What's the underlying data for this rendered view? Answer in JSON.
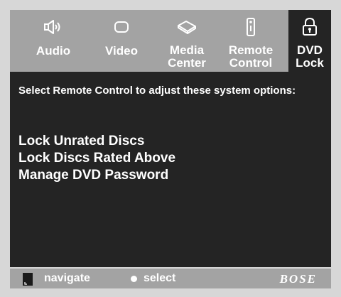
{
  "tabs": [
    {
      "id": "audio",
      "lines": [
        "Audio"
      ],
      "icon": "speaker-icon",
      "active": false
    },
    {
      "id": "video",
      "lines": [
        "Video"
      ],
      "icon": "screen-icon",
      "active": false
    },
    {
      "id": "media-center",
      "lines": [
        "Media",
        "Center"
      ],
      "icon": "media-center-icon",
      "active": false
    },
    {
      "id": "remote-control",
      "lines": [
        "Remote",
        "Control"
      ],
      "icon": "remote-icon",
      "active": false
    },
    {
      "id": "dvd-lock",
      "lines": [
        "DVD",
        "Lock"
      ],
      "icon": "padlock-icon",
      "active": true
    }
  ],
  "panel": {
    "instruction": "Select Remote Control to adjust these system options:",
    "options": [
      "Lock Unrated Discs",
      "Lock Discs Rated Above",
      "Manage DVD Password"
    ]
  },
  "footer": {
    "navigate": "navigate",
    "select": "select",
    "brand": "BOSE"
  },
  "colors": {
    "background": "#d7d7d7",
    "bar": "#a3a3a3",
    "panel": "#242424",
    "text": "#ffffff"
  }
}
